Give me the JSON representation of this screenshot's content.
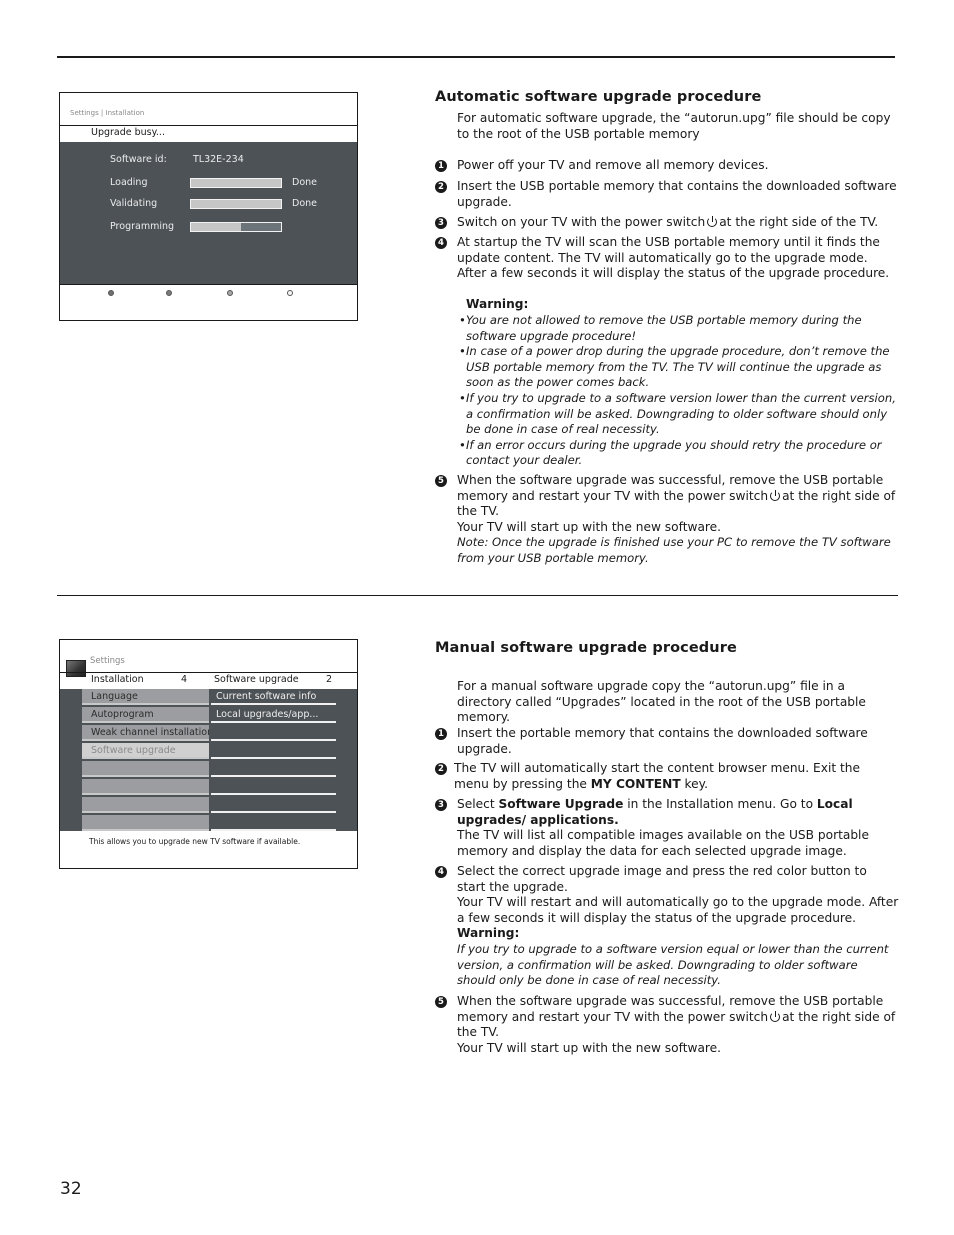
{
  "page_number": "32",
  "screen1": {
    "breadcrumb": "Settings | Installation",
    "title": "Upgrade busy...",
    "software_id_label": "Software id:",
    "software_id_value": "TL32E-234",
    "rows": [
      {
        "label": "Loading",
        "progress": 1.0,
        "status": "Done"
      },
      {
        "label": "Validating",
        "progress": 1.0,
        "status": "Done"
      },
      {
        "label": "Programming",
        "progress": 0.55,
        "status": ""
      }
    ],
    "color_dots": [
      "#6f6f6f",
      "#7a7a7a",
      "#a5a5a5",
      "#f5f5f5"
    ]
  },
  "screen2": {
    "breadcrumb": "Settings",
    "left_header": "Installation",
    "left_count": "4",
    "right_header": "Software upgrade",
    "right_count": "2",
    "left_items": [
      "Language",
      "Autoprogram",
      "Weak channel installation",
      "Software upgrade",
      "",
      "",
      "",
      ""
    ],
    "selected_index": 3,
    "right_items": [
      "Current software info",
      "Local upgrades/app...",
      "",
      "",
      "",
      "",
      "",
      ""
    ],
    "help": "This allows you to upgrade new TV software if available."
  },
  "auto": {
    "heading": "Automatic software upgrade procedure",
    "intro": "For automatic software upgrade, the “autorun.upg” file should be copy to the root of the USB portable memory",
    "steps": [
      {
        "num": "1",
        "text": "Power off your TV and remove all memory devices."
      },
      {
        "num": "2",
        "text": "Insert the USB portable memory that contains the downloaded software upgrade."
      },
      {
        "num": "3",
        "text_before": "Switch on your TV with the power switch",
        "text_after": "at the right side of the TV."
      },
      {
        "num": "4",
        "text": "At startup the TV will scan the USB portable memory until it finds the update content. The TV will automatically go to the upgrade mode. After a few seconds it will display the status of the upgrade procedure."
      }
    ],
    "warning_title": "Warning:",
    "warnings": [
      "You are not allowed to remove the USB portable memory during the software upgrade procedure!",
      "In case of a power drop during the upgrade procedure, don’t remove the USB portable memory from the TV. The TV will continue the upgrade as soon as the power comes back.",
      "If you try to upgrade to a software version lower than the current version, a confirmation will be asked. Downgrading to older software should only be done in case of real necessity.",
      "If an error occurs during the upgrade you should retry the procedure or contact your dealer."
    ],
    "step5": {
      "num": "5",
      "text_before": "When the software upgrade was successful, remove the USB portable memory and restart your TV with the power switch",
      "text_after": "at the right side of the TV.",
      "line2": "Your TV will start up with the new software.",
      "note": "Note: Once the upgrade is finished use your PC to remove the TV software from your USB portable memory."
    }
  },
  "manual": {
    "heading": "Manual software upgrade procedure",
    "intro": "For a manual software upgrade copy the “autorun.upg” file in a directory called “Upgrades” located in the root of the USB portable memory.",
    "step1": {
      "num": "1",
      "text": "Insert the portable memory that contains the downloaded software upgrade."
    },
    "step2": {
      "num": "2",
      "text_before": "The TV will automatically start the content browser menu. Exit the menu by pressing the",
      "key": "MY CONTENT",
      "text_after": "key."
    },
    "step3": {
      "num": "3",
      "t1": "Select",
      "b1": "Software Upgrade",
      "t2": "in the Installation menu. Go to",
      "b2": "Local upgrades/ applications.",
      "line2": "The TV will list all compatible images available on the USB portable memory and display the data for each selected upgrade image."
    },
    "step4": {
      "num": "4",
      "text": "Select the correct upgrade image and press the red color button to start the upgrade.",
      "line2": "Your TV will restart and will automatically go to the upgrade mode. After a few seconds it will display the status of the upgrade procedure.",
      "warning_title": "Warning:",
      "warning": "If you try to upgrade to a software version equal or lower than the current version, a confirmation will be asked. Downgrading to older software should only be done in case of real necessity."
    },
    "step5": {
      "num": "5",
      "text_before": "When the software upgrade was successful, remove the USB portable memory and restart your TV with the power switch",
      "text_after": "at the right side of the TV.",
      "line2": "Your TV will start up with the new software."
    }
  }
}
